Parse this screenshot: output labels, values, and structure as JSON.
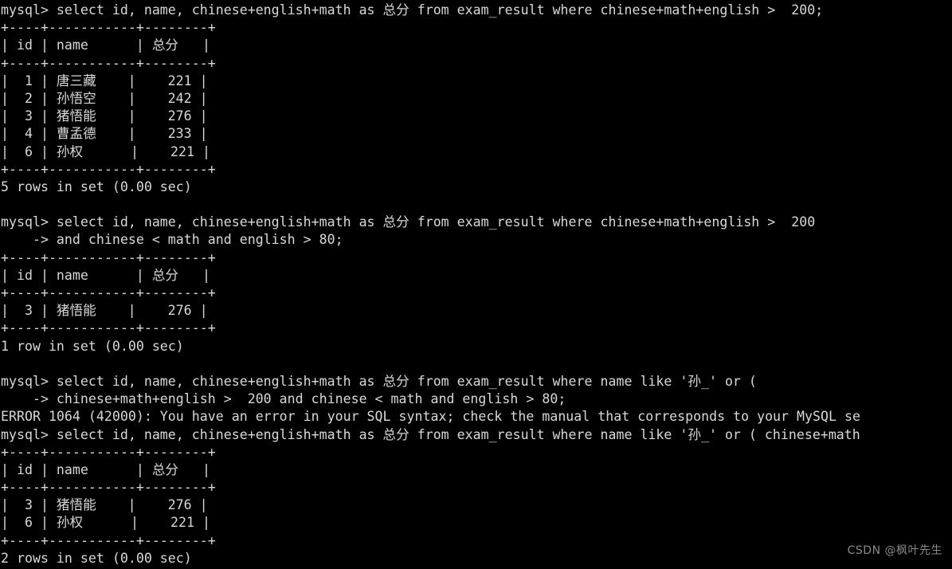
{
  "terminal": {
    "app": "mysql-client",
    "prompt": "mysql>",
    "continuation_prompt": "    ->",
    "colors": {
      "background": "#000000",
      "foreground": "#d8d8d8",
      "watermark": "#8a8a8a"
    },
    "lines": [
      "mysql> select id, name, chinese+english+math as 总分 from exam_result where chinese+math+english >  200;",
      "+----+-----------+--------+",
      "| id | name      | 总分   |",
      "+----+-----------+--------+",
      "|  1 | 唐三藏    |    221 |",
      "|  2 | 孙悟空    |    242 |",
      "|  3 | 猪悟能    |    276 |",
      "|  4 | 曹孟德    |    233 |",
      "|  6 | 孙权      |    221 |",
      "+----+-----------+--------+",
      "5 rows in set (0.00 sec)",
      "",
      "mysql> select id, name, chinese+english+math as 总分 from exam_result where chinese+math+english >  200",
      "    -> and chinese < math and english > 80;",
      "+----+-----------+--------+",
      "| id | name      | 总分   |",
      "+----+-----------+--------+",
      "|  3 | 猪悟能    |    276 |",
      "+----+-----------+--------+",
      "1 row in set (0.00 sec)",
      "",
      "mysql> select id, name, chinese+english+math as 总分 from exam_result where name like '孙_' or (",
      "    -> chinese+math+english >  200 and chinese < math and english > 80;",
      "ERROR 1064 (42000): You have an error in your SQL syntax; check the manual that corresponds to your MySQL se",
      "mysql> select id, name, chinese+english+math as 总分 from exam_result where name like '孙_' or ( chinese+math",
      "+----+-----------+--------+",
      "| id | name      | 总分   |",
      "+----+-----------+--------+",
      "|  3 | 猪悟能    |    276 |",
      "|  6 | 孙权      |    221 |",
      "+----+-----------+--------+",
      "2 rows in set (0.00 sec)"
    ]
  },
  "watermark": {
    "text": "CSDN @枫叶先生"
  },
  "tables": [
    {
      "columns": [
        "id",
        "name",
        "总分"
      ],
      "rows": [
        [
          "1",
          "唐三藏",
          "221"
        ],
        [
          "2",
          "孙悟空",
          "242"
        ],
        [
          "3",
          "猪悟能",
          "276"
        ],
        [
          "4",
          "曹孟德",
          "233"
        ],
        [
          "6",
          "孙权",
          "221"
        ]
      ],
      "status": "5 rows in set (0.00 sec)"
    },
    {
      "columns": [
        "id",
        "name",
        "总分"
      ],
      "rows": [
        [
          "3",
          "猪悟能",
          "276"
        ]
      ],
      "status": "1 row in set (0.00 sec)"
    },
    {
      "columns": [
        "id",
        "name",
        "总分"
      ],
      "rows": [
        [
          "3",
          "猪悟能",
          "276"
        ],
        [
          "6",
          "孙权",
          "221"
        ]
      ],
      "status": "2 rows in set (0.00 sec)"
    }
  ]
}
